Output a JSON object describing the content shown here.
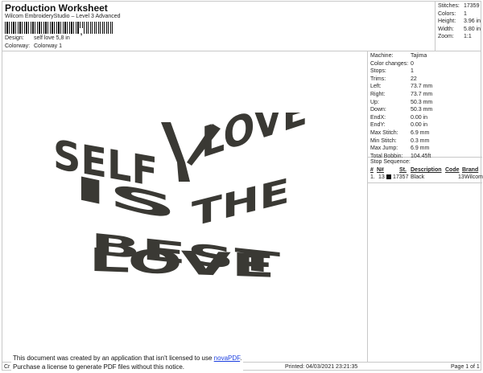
{
  "header": {
    "title": "Production Worksheet",
    "subtitle": "Wilcom EmbroideryStudio – Level 3 Advanced",
    "barcode_separator": ",",
    "design_label": "Design:",
    "design_value": "self love 5,8 in",
    "colorway_label": "Colorway:",
    "colorway_value": "Colorway 1"
  },
  "stats": [
    {
      "label": "Stitches:",
      "value": "17359"
    },
    {
      "label": "Colors:",
      "value": "1"
    },
    {
      "label": "Height:",
      "value": "3.96 in"
    },
    {
      "label": "Width:",
      "value": "5.80 in"
    },
    {
      "label": "Zoom:",
      "value": "1:1"
    }
  ],
  "details": [
    {
      "label": "Machine:",
      "value": "Tajima"
    },
    {
      "label": "Color changes:",
      "value": "0"
    },
    {
      "label": "Stops:",
      "value": "1"
    },
    {
      "label": "Trims:",
      "value": "22"
    },
    {
      "label": "Left:",
      "value": "73.7 mm"
    },
    {
      "label": "Right:",
      "value": "73.7 mm"
    },
    {
      "label": "Up:",
      "value": "50.3 mm"
    },
    {
      "label": "Down:",
      "value": "50.3 mm"
    },
    {
      "label": "EndX:",
      "value": "0.00 in"
    },
    {
      "label": "EndY:",
      "value": "0.00 in"
    },
    {
      "label": "Max Stitch:",
      "value": "6.9 mm"
    },
    {
      "label": "Min Stitch:",
      "value": "0.3 mm"
    },
    {
      "label": "Max Jump:",
      "value": "6.9 mm"
    },
    {
      "label": "Total Bobbin:",
      "value": "104.45ft"
    }
  ],
  "stop_sequence": {
    "title": "Stop Sequence:",
    "columns": [
      "#",
      "N#",
      "St.",
      "Description",
      "Code",
      "Brand"
    ],
    "rows": [
      {
        "num": "1.",
        "needle": "13",
        "color": "#111111",
        "stitches": "17357",
        "description": "Black",
        "code": "13",
        "brand": "Wilcom"
      }
    ]
  },
  "design": {
    "lettering": [
      "SELF",
      "LOVE",
      "IS",
      "THE",
      "BEST",
      "LOVE"
    ],
    "thread_color": "#3a3934"
  },
  "footer": {
    "left": "Cr",
    "printed": "Printed: 04/03/2021 23:21:35",
    "page": "Page 1 of 1"
  },
  "notice": {
    "line1": "This document was created by an application that isn't licensed to use ",
    "link": "novaPDF",
    "line1_end": ".",
    "line2": "Purchase a license to generate PDF files without this notice."
  }
}
